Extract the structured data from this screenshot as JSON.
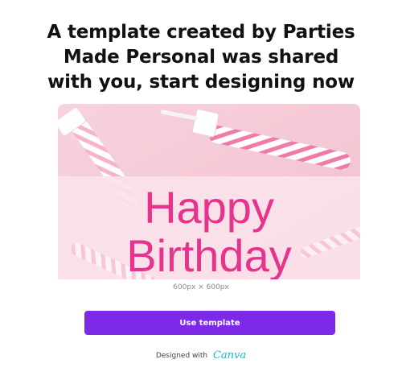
{
  "headline": "A template created by Parties Made Personal was shared with you, start designing now",
  "template_preview": {
    "line1": "Happy",
    "line2": "Birthday",
    "text_color": "#e6338c",
    "band_color": "#fbe2ea",
    "background_color": "#f5c9d5"
  },
  "dimensions": "600px × 600px",
  "use_template_button": {
    "label": "Use template",
    "color": "#7d2ae8"
  },
  "footer": {
    "designed_with": "Designed with",
    "brand": "Canva",
    "brand_color": "#1fb6c9"
  }
}
